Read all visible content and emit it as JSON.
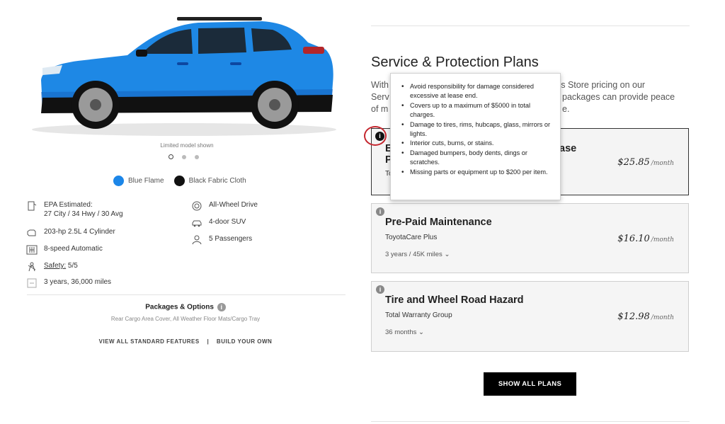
{
  "gallery": {
    "caption": "Limited model shown",
    "slide_count": 3,
    "active_slide": 1
  },
  "colors": [
    {
      "name": "Blue Flame",
      "hex": "#1c86e8"
    },
    {
      "name": "Black Fabric Cloth",
      "hex": "#111111"
    }
  ],
  "specs": {
    "epa_label": "EPA Estimated:",
    "epa_value": "27 City / 34 Hwy / 30 Avg",
    "engine": "203-hp 2.5L 4 Cylinder",
    "transmission": "8-speed Automatic",
    "safety_label": "Safety:",
    "safety_value": "5/5",
    "warranty": "3 years, 36,000 miles",
    "drivetrain": "All-Wheel Drive",
    "body": "4-door SUV",
    "seating": "5 Passengers"
  },
  "packages": {
    "title": "Packages & Options",
    "description": "Rear Cargo Area Cover, All Weather Floor Mats/Cargo Tray"
  },
  "links": {
    "view_all": "VIEW ALL STANDARD FEATURES",
    "separator": "|",
    "build": "BUILD YOUR OWN"
  },
  "service": {
    "title": "Service & Protection Plans",
    "intro_lines": [
      {
        "left": "With",
        "right": "ss Store pricing on our"
      },
      {
        "left": "Serv",
        "right": "packages can provide peace"
      },
      {
        "left": "of m",
        "right": "e."
      }
    ]
  },
  "plans": [
    {
      "name_left": "E",
      "name_right": "ase",
      "name_line2": "P",
      "provider": "To",
      "price": "$25.85",
      "unit": "/month",
      "selected": true
    },
    {
      "name": "Pre-Paid Maintenance",
      "provider": "ToyotaCare Plus",
      "term": "3 years / 45K miles",
      "price": "$16.10",
      "unit": "/month"
    },
    {
      "name": "Tire and Wheel Road Hazard",
      "provider": "Total Warranty Group",
      "term": "36 months",
      "price": "$12.98",
      "unit": "/month"
    }
  ],
  "tooltip": {
    "items": [
      "Avoid responsibility for damage considered excessive at lease end.",
      "Covers up to a maximum of $5000 in total charges.",
      "Damage to tires, rims, hubcaps, glass, mirrors or lights.",
      "Interior cuts, burns, or stains.",
      "Damaged bumpers, body dents, dings or scratches.",
      "Missing parts or equipment up to $200 per item."
    ]
  },
  "show_all_label": "SHOW ALL PLANS",
  "accent_colors": {
    "car_body": "#1e88e5",
    "annotation_ring": "#c4262e"
  }
}
